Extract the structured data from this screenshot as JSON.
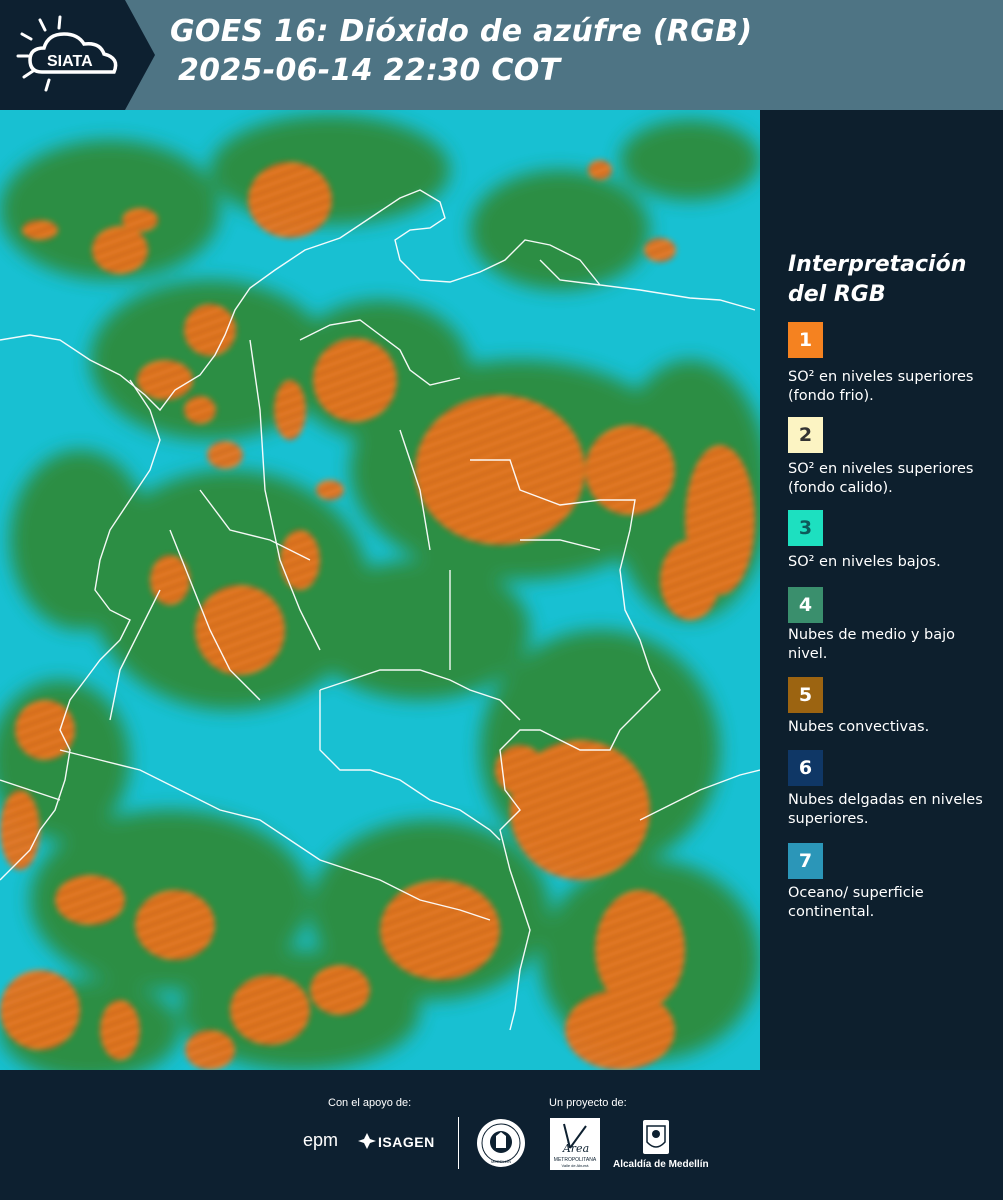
{
  "header": {
    "logo_text": "SIATA",
    "title_line1": "GOES 16: Dióxido de azúfre (RGB)",
    "title_line2": "2025-06-14 22:30 COT",
    "background_color": "#4e7484",
    "logo_background_color": "#0d2030"
  },
  "map": {
    "icon": "satellite-rgb-imagery",
    "ocean_color": "#18c0d2",
    "cloud_color": "#2f8a38",
    "so2_color": "#f07a22",
    "border_color": "#ffffff"
  },
  "legend": {
    "title": "Interpretación del RGB",
    "items": [
      {
        "number": "1",
        "label": "SO² en niveles superiores (fondo frio).",
        "color": "#f58220"
      },
      {
        "number": "2",
        "label": "SO² en niveles superiores (fondo calido).",
        "color": "#fcf4c3"
      },
      {
        "number": "3",
        "label": "SO² en niveles bajos.",
        "color": "#1de0c0"
      },
      {
        "number": "4",
        "label": "Nubes de medio y bajo nivel.",
        "color": "#3a8f6d"
      },
      {
        "number": "5",
        "label": "Nubes convectivas.",
        "color": "#9c6411"
      },
      {
        "number": "6",
        "label": "Nubes delgadas en niveles superiores.",
        "color": "#0f3766"
      },
      {
        "number": "7",
        "label": "Oceano/ superficie continental.",
        "color": "#2b96b8"
      }
    ]
  },
  "footer": {
    "support_label": "Con el apoyo de:",
    "project_label": "Un proyecto de:",
    "sponsor_epm": "epm",
    "sponsor_isagen": "ISAGEN",
    "logo_medellin_text": "MEDELLÍN",
    "logo_area_text": "Área",
    "logo_area_sub1": "METROPOLITANA",
    "logo_area_sub2": "Valle de Aburrá",
    "logo_alcaldia_text": "Alcaldía de Medellín"
  }
}
